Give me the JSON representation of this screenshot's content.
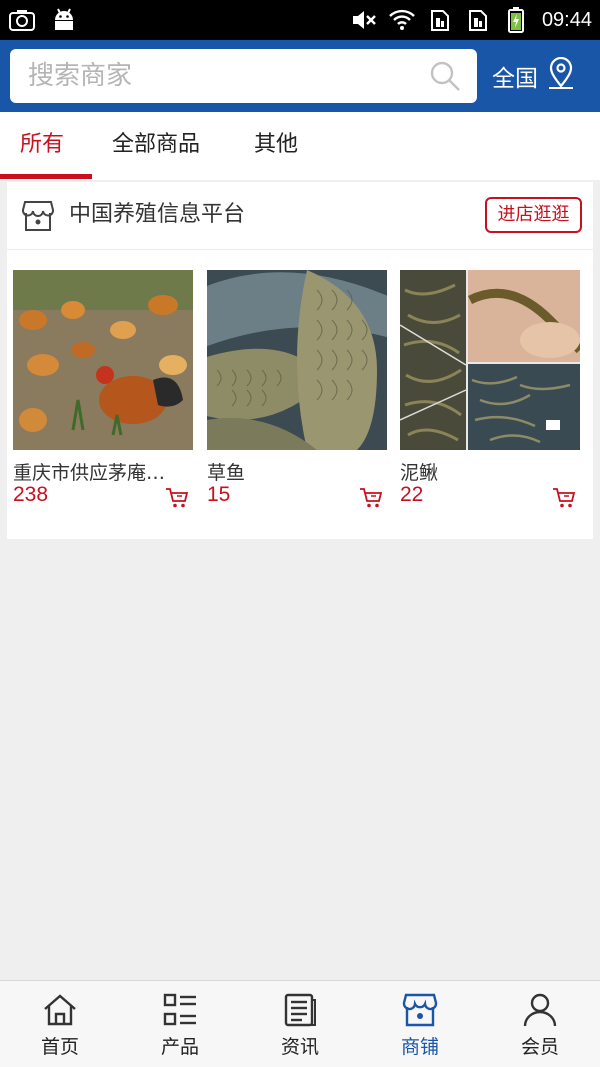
{
  "status_bar": {
    "time": "09:44",
    "icons": [
      "screenshot-icon",
      "android-icon",
      "mute-icon",
      "wifi-icon",
      "sim1-icon",
      "sim2-icon",
      "battery-icon"
    ]
  },
  "header": {
    "search_placeholder": "搜索商家",
    "region_label": "全国",
    "bg_color": "#1a56a8"
  },
  "tabs": [
    {
      "label": "所有",
      "active": true
    },
    {
      "label": "全部商品",
      "active": false
    },
    {
      "label": "其他",
      "active": false
    }
  ],
  "store": {
    "name": "中国养殖信息平台",
    "visit_label": "进店逛逛",
    "products": [
      {
        "name": "重庆市供应茅庵…",
        "price": "238"
      },
      {
        "name": "草鱼",
        "price": "15"
      },
      {
        "name": "泥鳅",
        "price": "22"
      }
    ]
  },
  "bottom_nav": [
    {
      "label": "首页",
      "icon": "home-icon",
      "active": false
    },
    {
      "label": "产品",
      "icon": "grid-list-icon",
      "active": false
    },
    {
      "label": "资讯",
      "icon": "news-icon",
      "active": false
    },
    {
      "label": "商铺",
      "icon": "shop-icon",
      "active": true
    },
    {
      "label": "会员",
      "icon": "user-icon",
      "active": false
    }
  ],
  "colors": {
    "accent_red": "#c8101e",
    "brand_blue": "#1a56a8"
  }
}
